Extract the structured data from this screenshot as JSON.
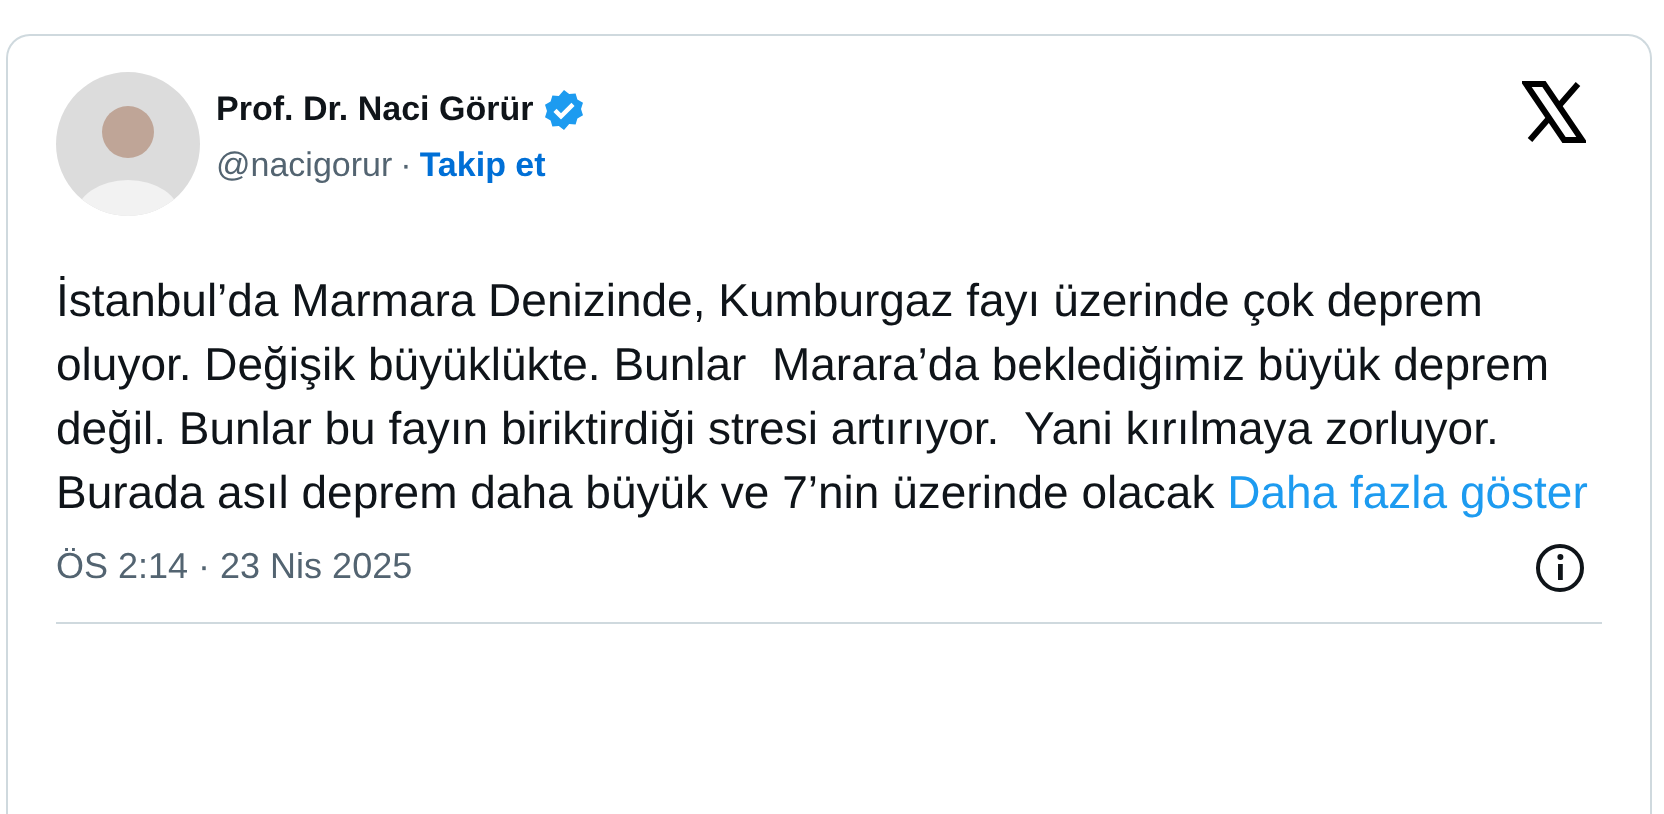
{
  "author": {
    "name": "Prof. Dr. Naci Görür",
    "verified": true,
    "handle": "@nacigorur",
    "separator": "·",
    "follow": "Takip et"
  },
  "body": {
    "text": "İstanbul’da Marmara Denizinde, Kumburgaz fayı üzerinde çok deprem oluyor. Değişik büyüklükte. Bunlar  Marara’da beklediğimiz büyük deprem değil. Bunlar bu fayın biriktirdiği stresi artırıyor.  Yani kırılmaya zorluyor. Burada asıl deprem daha büyük ve 7’nin üzerinde olacak",
    "more": "Daha fazla göster"
  },
  "footer": {
    "time": "ÖS 2:14 · 23 Nis 2025"
  }
}
